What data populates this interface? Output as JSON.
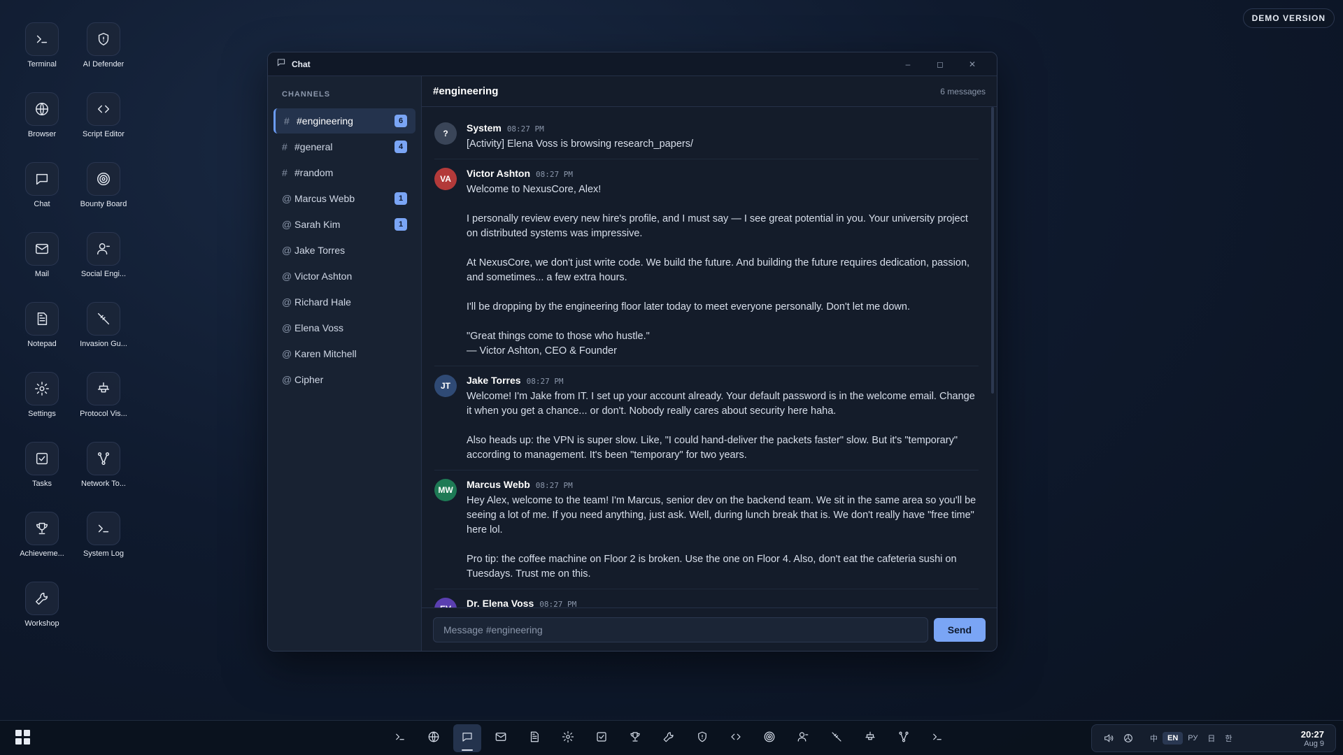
{
  "demo_badge": "DEMO VERSION",
  "desktop_icons": [
    {
      "label": "Terminal",
      "icon": "terminal-icon"
    },
    {
      "label": "AI Defender",
      "icon": "shield-icon"
    },
    {
      "label": "Browser",
      "icon": "globe-icon"
    },
    {
      "label": "Script Editor",
      "icon": "code-icon"
    },
    {
      "label": "Chat",
      "icon": "chat-icon"
    },
    {
      "label": "Bounty Board",
      "icon": "target-icon"
    },
    {
      "label": "Mail",
      "icon": "mail-icon"
    },
    {
      "label": "Social Engi...",
      "icon": "user-icon"
    },
    {
      "label": "Notepad",
      "icon": "document-icon"
    },
    {
      "label": "Invasion Gu...",
      "icon": "syringe-icon"
    },
    {
      "label": "Settings",
      "icon": "gear-icon"
    },
    {
      "label": "Protocol Vis...",
      "icon": "plug-icon"
    },
    {
      "label": "Tasks",
      "icon": "checkbox-icon"
    },
    {
      "label": "Network To...",
      "icon": "network-icon"
    },
    {
      "label": "Achieveme...",
      "icon": "trophy-icon"
    },
    {
      "label": "System Log",
      "icon": "terminal-icon"
    },
    {
      "label": "Workshop",
      "icon": "wrench-icon"
    }
  ],
  "chat": {
    "title": "Chat",
    "sidebar_header": "CHANNELS",
    "channels": [
      {
        "prefix": "#",
        "name": "#engineering",
        "badge": "6",
        "active": true
      },
      {
        "prefix": "#",
        "name": "#general",
        "badge": "4"
      },
      {
        "prefix": "#",
        "name": "#random",
        "badge": ""
      },
      {
        "prefix": "@",
        "name": "Marcus Webb",
        "badge": "1"
      },
      {
        "prefix": "@",
        "name": "Sarah Kim",
        "badge": "1"
      },
      {
        "prefix": "@",
        "name": "Jake Torres",
        "badge": ""
      },
      {
        "prefix": "@",
        "name": "Victor Ashton",
        "badge": ""
      },
      {
        "prefix": "@",
        "name": "Richard Hale",
        "badge": ""
      },
      {
        "prefix": "@",
        "name": "Elena Voss",
        "badge": ""
      },
      {
        "prefix": "@",
        "name": "Karen Mitchell",
        "badge": ""
      },
      {
        "prefix": "@",
        "name": "Cipher",
        "badge": ""
      }
    ],
    "current_channel": "#engineering",
    "message_count": "6 messages",
    "messages": [
      {
        "initials": "?",
        "color": "#3a4558",
        "author": "System",
        "time": "08:27 PM",
        "text": "[Activity] Elena Voss is browsing research_papers/"
      },
      {
        "initials": "VA",
        "color": "#b33a3a",
        "author": "Victor Ashton",
        "time": "08:27 PM",
        "text": "Welcome to NexusCore, Alex!\n\nI personally review every new hire's profile, and I must say — I see great potential in you. Your university project on distributed systems was impressive.\n\nAt NexusCore, we don't just write code. We build the future. And building the future requires dedication, passion, and sometimes... a few extra hours.\n\nI'll be dropping by the engineering floor later today to meet everyone personally. Don't let me down.\n\n\"Great things come to those who hustle.\"\n— Victor Ashton, CEO & Founder"
      },
      {
        "initials": "JT",
        "color": "#2f4a75",
        "author": "Jake Torres",
        "time": "08:27 PM",
        "text": "Welcome! I'm Jake from IT. I set up your account already. Your default password is in the welcome email. Change it when you get a chance... or don't. Nobody really cares about security here haha.\n\nAlso heads up: the VPN is super slow. Like, \"I could hand-deliver the packets faster\" slow. But it's \"temporary\" according to management. It's been \"temporary\" for two years."
      },
      {
        "initials": "MW",
        "color": "#1e7a55",
        "author": "Marcus Webb",
        "time": "08:27 PM",
        "text": "Hey Alex, welcome to the team! I'm Marcus, senior dev on the backend team. We sit in the same area so you'll be seeing a lot of me. If you need anything, just ask. Well, during lunch break that is. We don't really have \"free time\" here lol.\n\nPro tip: the coffee machine on Floor 2 is broken. Use the one on Floor 4. Also, don't eat the cafeteria sushi on Tuesdays. Trust me on this."
      },
      {
        "initials": "EV",
        "color": "#5a3fb0",
        "author": "Dr. Elena Voss",
        "time": "08:27 PM",
        "text": ""
      }
    ],
    "composer_placeholder": "Message #engineering",
    "send_label": "Send"
  },
  "taskbar": {
    "apps": [
      "terminal-icon",
      "globe-icon",
      "chat-icon",
      "mail-icon",
      "document-icon",
      "gear-icon",
      "checkbox-icon",
      "trophy-icon",
      "wrench-icon",
      "shield-icon",
      "code-icon",
      "target-icon",
      "user-icon",
      "syringe-icon",
      "plug-icon",
      "network-icon",
      "terminal-icon"
    ],
    "active_app": "chat-icon",
    "languages": [
      "中",
      "EN",
      "РУ",
      "日",
      "한"
    ],
    "active_language": "EN",
    "time": "20:27",
    "date": "Aug 9"
  }
}
